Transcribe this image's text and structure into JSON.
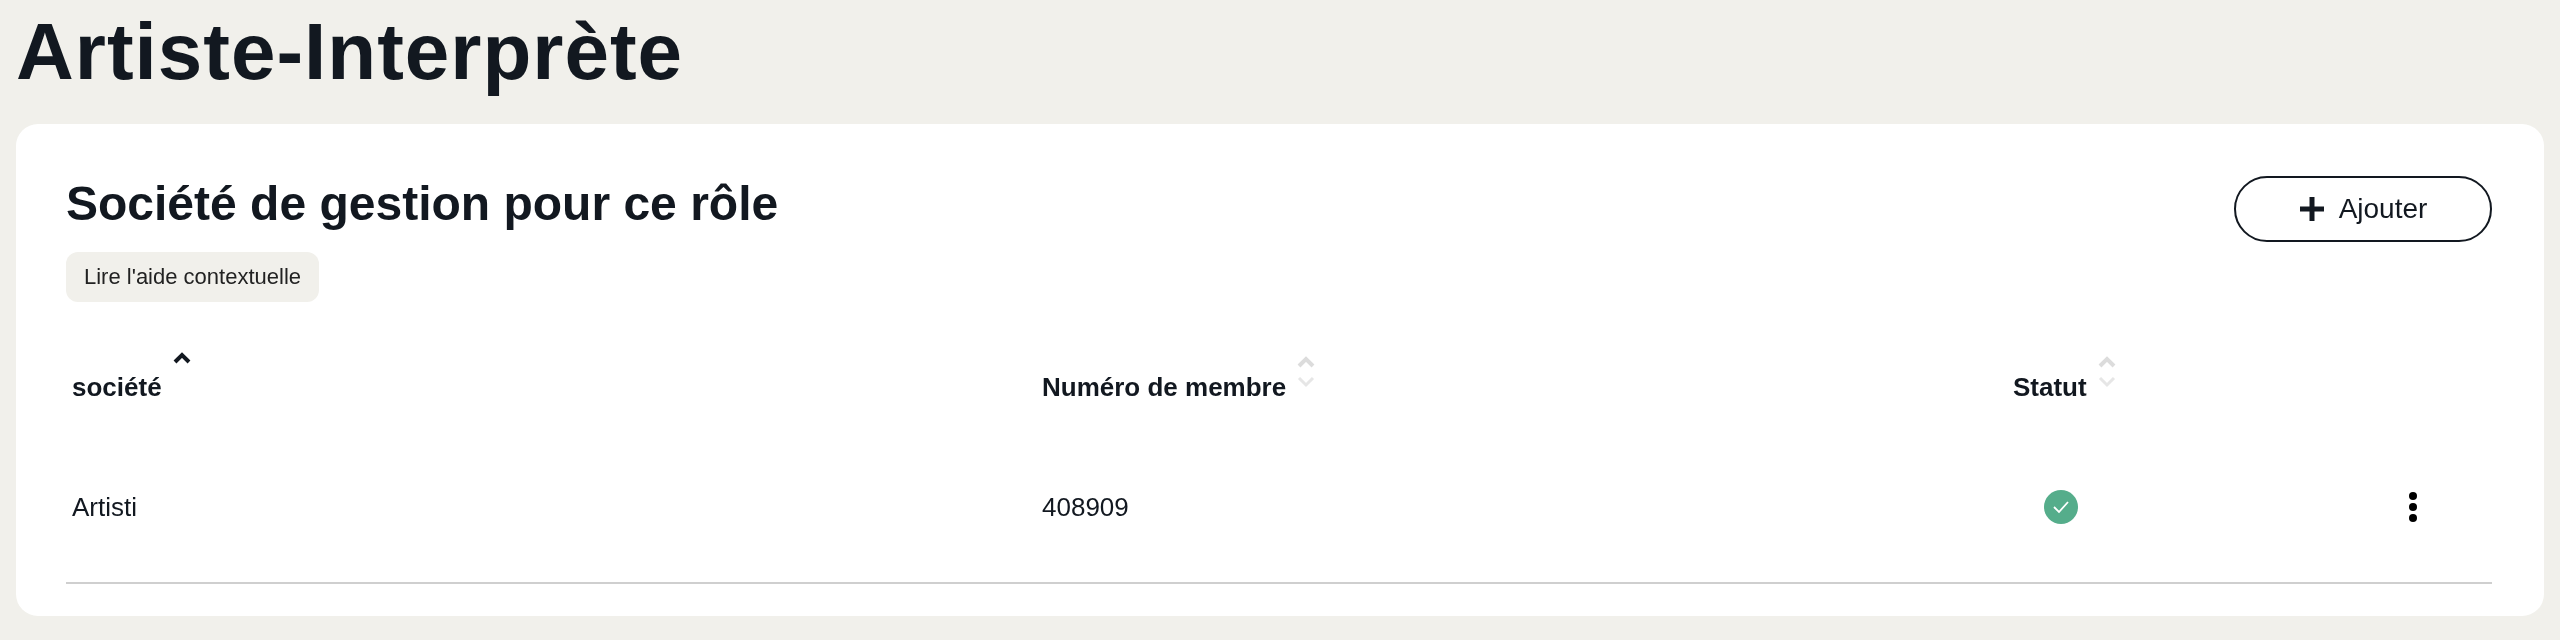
{
  "page_title": "Artiste-Interprète",
  "section": {
    "title": "Société de gestion pour ce rôle",
    "help_link": "Lire l'aide contextuelle",
    "add_button": "Ajouter"
  },
  "table": {
    "columns": [
      {
        "label": "société",
        "sorted_ascending": true
      },
      {
        "label": "Numéro de membre",
        "sorted_ascending": false
      },
      {
        "label": "Statut",
        "sorted_ascending": false
      }
    ],
    "rows": [
      {
        "societe": "Artisti",
        "member_number": "408909",
        "valid": true
      }
    ]
  }
}
